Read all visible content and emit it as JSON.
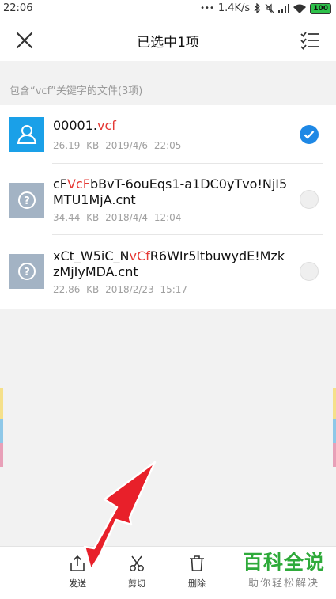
{
  "status_bar": {
    "time": "22:06",
    "dots": "•••",
    "speed": "1.4K/s",
    "battery": "100"
  },
  "title_bar": {
    "title": "已选中1项"
  },
  "section": {
    "header": "包含“vcf”关键字的文件(3项)"
  },
  "files": [
    {
      "name_parts": [
        "00001.",
        "vcf",
        ""
      ],
      "size": "26.19 KB",
      "date": "2019/4/6 22:05",
      "icon": "contact-icon",
      "selected": true
    },
    {
      "name_parts": [
        "cF",
        "VcF",
        "bBvT-6ouEqs1-a1DC0yTvo!NjI5MTU1MjA.cnt"
      ],
      "size": "34.44 KB",
      "date": "2018/4/4 12:04",
      "icon": "unknown-file-icon",
      "selected": false
    },
    {
      "name_parts": [
        "xCt_W5iC_N",
        "vCf",
        "R6WIr5ltbuwydE!MzkzMjIyMDA.cnt"
      ],
      "size": "22.86 KB",
      "date": "2018/2/23 15:17",
      "icon": "unknown-file-icon",
      "selected": false
    }
  ],
  "actions": {
    "send": "发送",
    "cut": "剪切",
    "delete": "删除"
  },
  "watermark": {
    "title": "百科全说",
    "subtitle": "助你轻松解决"
  },
  "colors": {
    "highlight": "#e53935",
    "check": "#1e88e5",
    "arrow": "#e8202a",
    "watermark": "#2eaa3a"
  }
}
